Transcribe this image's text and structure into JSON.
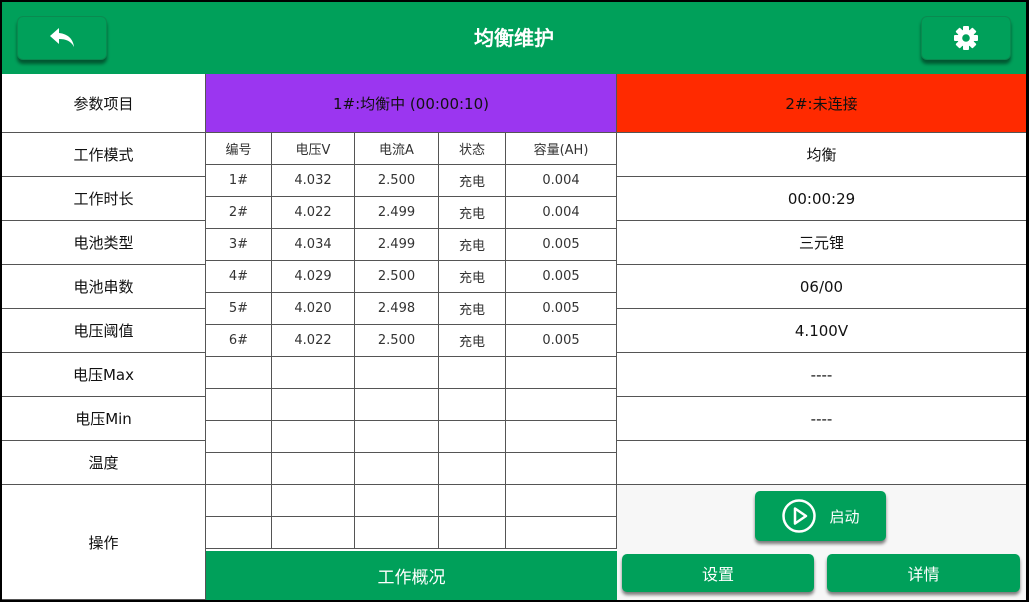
{
  "header": {
    "title": "均衡维护",
    "back_icon": "back-arrow-icon",
    "settings_icon": "gear-icon"
  },
  "params": {
    "header": "参数项目",
    "rows": [
      "工作模式",
      "工作时长",
      "电池类型",
      "电池串数",
      "电压阈值",
      "电压Max",
      "电压Min",
      "温度",
      "操作"
    ]
  },
  "ch1": {
    "status": "1#:均衡中 (00:00:10)",
    "status_color": "#9b36f0"
  },
  "ch2": {
    "status": "2#:未连接",
    "status_color": "#ff2a00",
    "values": [
      "均衡",
      "00:00:29",
      "三元锂",
      "06/00",
      "4.100V",
      "----",
      "----",
      ""
    ]
  },
  "table": {
    "columns": [
      "编号",
      "电压V",
      "电流A",
      "状态",
      "容量(AH)"
    ],
    "rows": [
      [
        "1#",
        "4.032",
        "2.500",
        "充电",
        "0.004"
      ],
      [
        "2#",
        "4.022",
        "2.499",
        "充电",
        "0.004"
      ],
      [
        "3#",
        "4.034",
        "2.499",
        "充电",
        "0.005"
      ],
      [
        "4#",
        "4.029",
        "2.500",
        "充电",
        "0.005"
      ],
      [
        "5#",
        "4.020",
        "2.498",
        "充电",
        "0.005"
      ],
      [
        "6#",
        "4.022",
        "2.500",
        "充电",
        "0.005"
      ]
    ],
    "empty_rows": 6
  },
  "buttons": {
    "overview": "工作概况",
    "start": "启动",
    "start_icon": "play-circle-icon",
    "settings": "设置",
    "details": "详情"
  },
  "colors": {
    "accent": "#00a05a"
  }
}
